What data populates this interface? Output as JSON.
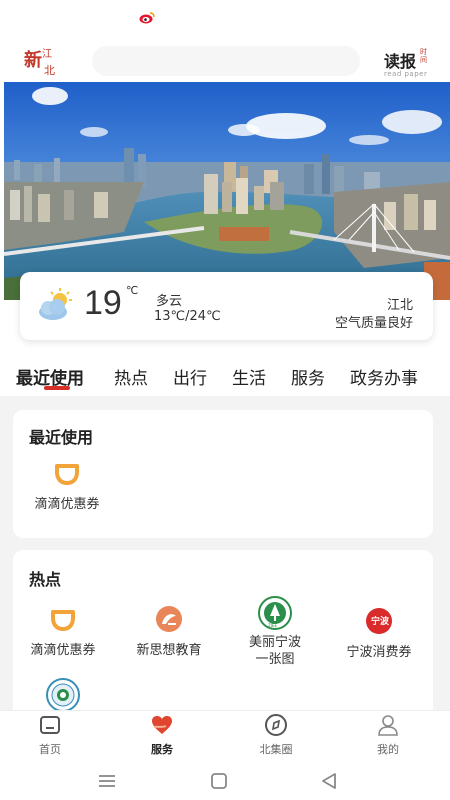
{
  "status_bar": {
    "icon": "weibo-icon"
  },
  "header": {
    "logo_icon": "xin-jiangbei-logo",
    "search_placeholder": "",
    "read_paper": {
      "main": "读报",
      "side": "时间",
      "sub": "read paper"
    }
  },
  "banner": {
    "image": "city-river-aerial-photo"
  },
  "weather": {
    "icon": "partly-cloudy-icon",
    "temperature": "19",
    "unit": "℃",
    "condition": "多云",
    "range": "13℃/24℃",
    "location": "江北",
    "air_quality": "空气质量良好"
  },
  "tabs": [
    {
      "label": "最近使用",
      "active": true
    },
    {
      "label": "热点",
      "active": false
    },
    {
      "label": "出行",
      "active": false
    },
    {
      "label": "生活",
      "active": false
    },
    {
      "label": "服务",
      "active": false
    },
    {
      "label": "政务办事",
      "active": false
    }
  ],
  "recent": {
    "title": "最近使用",
    "apps": [
      {
        "label": "滴滴优惠券",
        "icon": "didi-icon"
      }
    ]
  },
  "hot": {
    "title": "热点",
    "apps": [
      {
        "label": "滴滴优惠券",
        "icon": "didi-icon"
      },
      {
        "label": "新思想教育",
        "icon": "xinsixiang-icon"
      },
      {
        "label": "美丽宁波一张图",
        "icon": "meili-ningbo-icon"
      },
      {
        "label": "宁波消费券",
        "icon": "ningbo-coupon-icon"
      },
      {
        "label": "",
        "icon": "government-seal-icon"
      }
    ]
  },
  "bottom_nav": [
    {
      "label": "首页",
      "icon": "home-icon",
      "active": false
    },
    {
      "label": "服务",
      "icon": "heart-hands-icon",
      "active": true
    },
    {
      "label": "北集圈",
      "icon": "compass-icon",
      "active": false
    },
    {
      "label": "我的",
      "icon": "profile-icon",
      "active": false
    }
  ],
  "colors": {
    "accent": "#d6302b",
    "didi_orange": "#f2a33a",
    "bg_gray": "#f3f3f3"
  }
}
